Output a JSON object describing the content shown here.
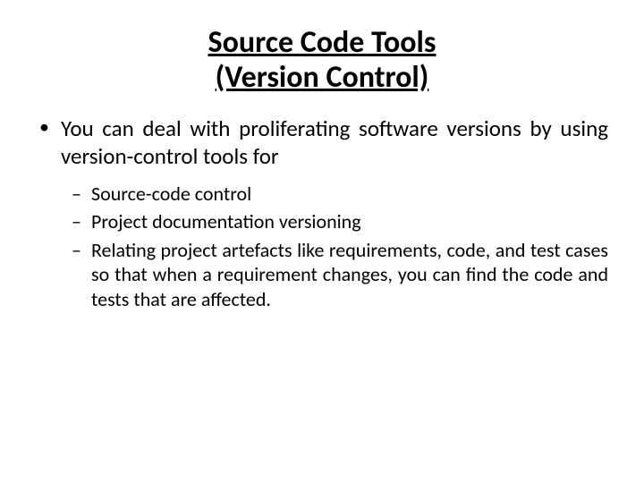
{
  "title_line1": "Source Code Tools",
  "title_line2": "(Version Control)",
  "main_bullet": "You can deal with proliferating software versions by using version-control tools for",
  "sub": [
    "Source-code control",
    "Project documentation versioning",
    "Relating project artefacts like requirements, code, and test cases so that when a requirement changes, you can find the code and tests that are affected."
  ]
}
